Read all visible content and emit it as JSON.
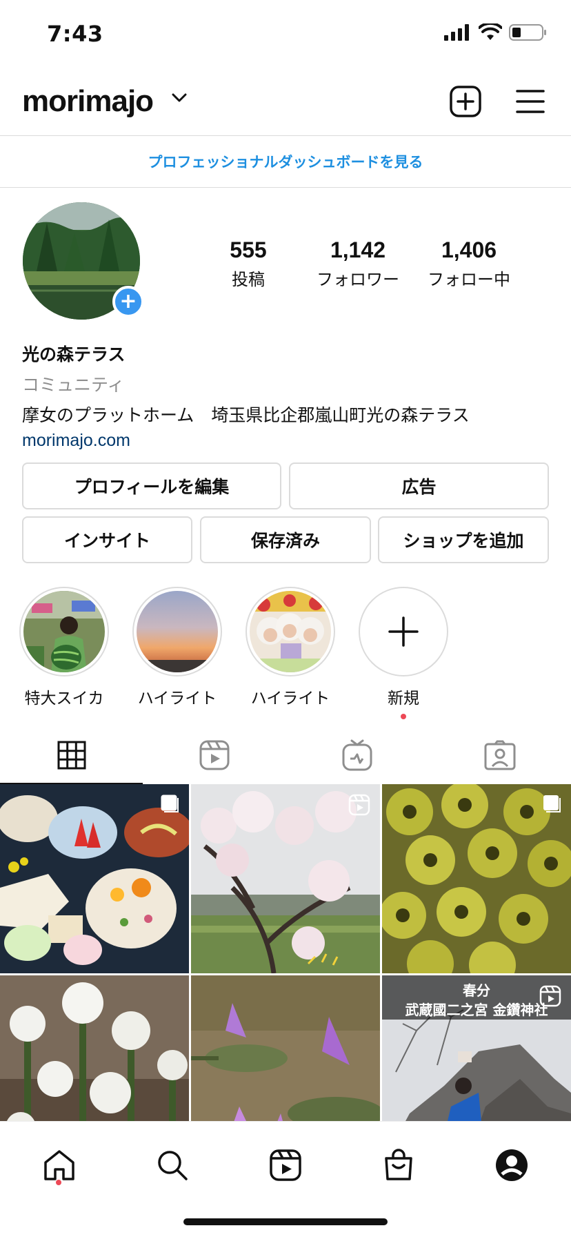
{
  "status_bar": {
    "time": "7:43"
  },
  "header": {
    "username": "morimajo"
  },
  "dashboard": {
    "label": "プロフェッショナルダッシュボードを見る"
  },
  "stats": [
    {
      "value": "555",
      "label": "投稿"
    },
    {
      "value": "1,142",
      "label": "フォロワー"
    },
    {
      "value": "1,406",
      "label": "フォロー中"
    }
  ],
  "bio": {
    "name": "光の森テラス",
    "category": "コミュニティ",
    "text": "摩女のプラットホーム　埼玉県比企郡嵐山町光の森テラス",
    "link": "morimajo.com"
  },
  "buttons": {
    "edit_profile": "プロフィールを編集",
    "ads": "広告",
    "insights": "インサイト",
    "saved": "保存済み",
    "add_shop": "ショップを追加"
  },
  "highlights": [
    {
      "label": "特大スイカ"
    },
    {
      "label": "ハイライト"
    },
    {
      "label": "ハイライト"
    },
    {
      "label": "新規"
    }
  ],
  "grid": {
    "reel_caption_line1": "春分",
    "reel_caption_line2": "武蔵國二之宮 金鑽神社"
  },
  "colors": {
    "accent_blue": "#3897f0",
    "link_blue": "#1d8fe0",
    "notification_red": "#ed4956"
  }
}
